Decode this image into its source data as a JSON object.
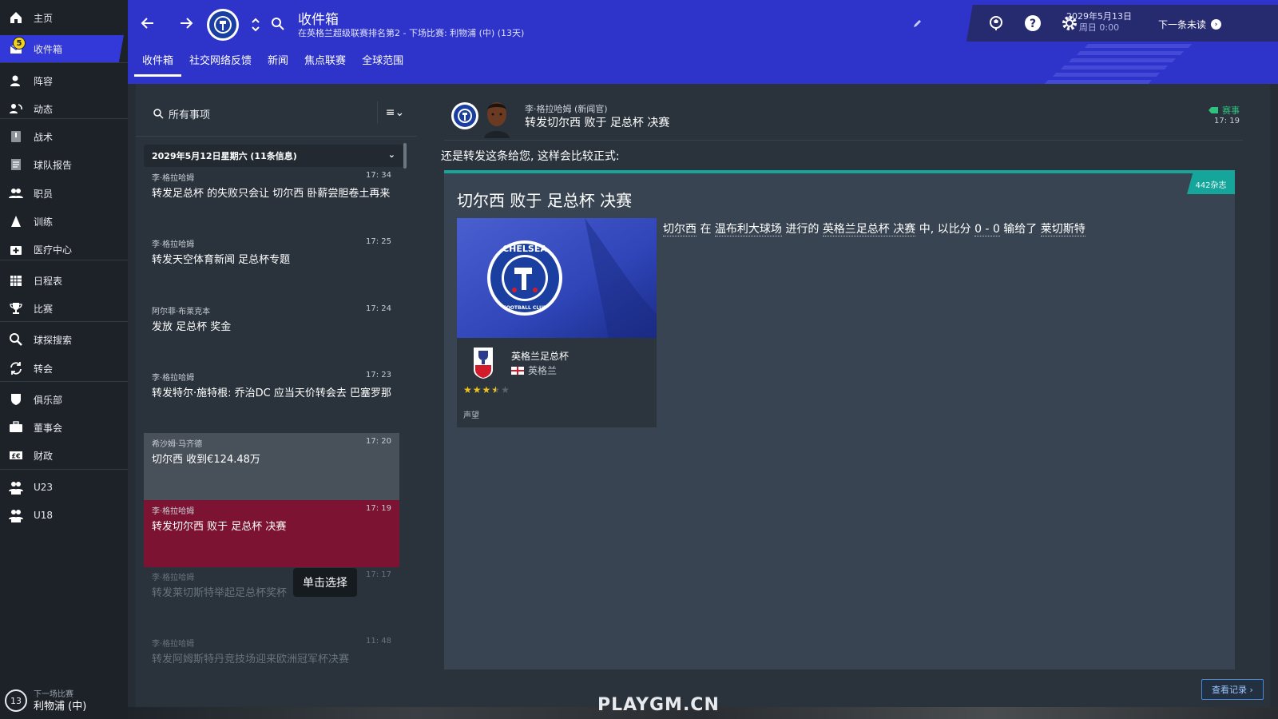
{
  "sidebar": {
    "items": [
      {
        "label": "主页",
        "icon": "home-icon"
      },
      {
        "label": "收件箱",
        "icon": "inbox-icon",
        "badge": "5"
      },
      {
        "label": "阵容",
        "icon": "squad-icon"
      },
      {
        "label": "动态",
        "icon": "dynamics-icon"
      },
      {
        "label": "战术",
        "icon": "tactics-icon"
      },
      {
        "label": "球队报告",
        "icon": "report-icon"
      },
      {
        "label": "职员",
        "icon": "staff-icon"
      },
      {
        "label": "训练",
        "icon": "training-icon"
      },
      {
        "label": "医疗中心",
        "icon": "medical-icon"
      },
      {
        "label": "日程表",
        "icon": "calendar-icon"
      },
      {
        "label": "比赛",
        "icon": "trophy-icon"
      },
      {
        "label": "球探搜索",
        "icon": "scouting-icon"
      },
      {
        "label": "转会",
        "icon": "transfer-icon"
      },
      {
        "label": "俱乐部",
        "icon": "club-icon"
      },
      {
        "label": "董事会",
        "icon": "board-icon"
      },
      {
        "label": "财政",
        "icon": "finance-icon"
      },
      {
        "label": "U23",
        "icon": "u23-icon"
      },
      {
        "label": "U18",
        "icon": "u18-icon"
      }
    ],
    "next_match": {
      "label": "下一场比赛",
      "value": "利物浦 (中)",
      "days": "13"
    }
  },
  "header": {
    "title": "收件箱",
    "subtitle": "在英格兰超级联赛排名第2 - 下场比赛: 利物浦 (中) (13天)",
    "tabs": [
      "收件箱",
      "社交网络反馈",
      "新闻",
      "焦点联赛",
      "全球范围"
    ],
    "date": "2029年5月13日",
    "time": "周日 0:00",
    "next_unread": "下一条未读",
    "accent": "#2e33c9"
  },
  "list": {
    "search_label": "所有事项",
    "group_header": "2029年5月12日星期六 (11条信息)",
    "messages": [
      {
        "from": "李·格拉哈姆",
        "time": "17: 34",
        "subject": "转发足总杯 的失败只会让 切尔西 卧薪尝胆卷土再来"
      },
      {
        "from": "李·格拉哈姆",
        "time": "17: 25",
        "subject": "转发天空体育新闻 足总杯专题"
      },
      {
        "from": "阿尔菲·布莱克本",
        "time": "17: 24",
        "subject": "发放 足总杯 奖金"
      },
      {
        "from": "李·格拉哈姆",
        "time": "17: 23",
        "subject": "转发特尔·施特根: 乔治DC 应当天价转会去 巴塞罗那"
      },
      {
        "from": "希沙姆·马齐德",
        "time": "17: 20",
        "subject": "切尔西 收到€124.48万"
      },
      {
        "from": "李·格拉哈姆",
        "time": "17: 19",
        "subject": "转发切尔西 败于 足总杯 决赛"
      },
      {
        "from": "李·格拉哈姆",
        "time": "17: 17",
        "subject": "转发莱切斯特举起足总杯奖杯"
      },
      {
        "from": "李·格拉哈姆",
        "time": "11: 48",
        "subject": "转发阿姆斯特丹竞技场迎来欧洲冠军杯决赛"
      }
    ],
    "tooltip": "单击选择"
  },
  "detail": {
    "sender": "李·格拉哈姆 (新闻官)",
    "subject": "转发切尔西 败于 足总杯 决赛",
    "tag": "赛事",
    "time": "17: 19",
    "intro": "还是转发这条给您, 这样会比较正式:",
    "card": {
      "badge": "442杂志",
      "title": "切尔西 败于 足总杯 决赛",
      "image_crest_text": "CHELSEA",
      "image_crest_bottom": "FOOTBALL CLUB",
      "competition": "英格兰足总杯",
      "country": "英格兰",
      "reputation_stars": 3.5,
      "reputation_label": "声望",
      "body": {
        "t1": "切尔西",
        "t2": " 在 ",
        "t3": "温布利大球场",
        "t4": " 进行的 ",
        "t5": "英格兰足总杯 决赛",
        "t6": " 中, 以比分 ",
        "t7": "0 - 0",
        "t8": " 输给了 ",
        "t9": "莱切斯特"
      }
    },
    "history_button": "查看记录 ›"
  },
  "watermark": "PLAYGM.CN"
}
